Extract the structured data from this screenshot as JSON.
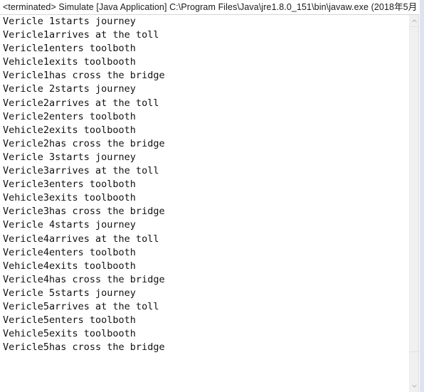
{
  "window": {
    "app": "Eclipse Console",
    "view": "Console"
  },
  "toolbar": {
    "ghost_buttons": [
      "toolbar-ghost-1",
      "toolbar-ghost-2",
      "toolbar-ghost-3"
    ]
  },
  "console": {
    "header": {
      "status": "<terminated>",
      "launch_name": "Simulate",
      "launch_type": "[Java Application]",
      "jvm_path": "C:\\Program Files\\Java\\jre1.8.0_151\\bin\\javaw.exe",
      "timestamp": "(2018年5月",
      "full_title": "<terminated> Simulate [Java Application] C:\\Program Files\\Java\\jre1.8.0_151\\bin\\javaw.exe (2018年5月"
    },
    "output_lines": [
      "Vericle 1starts journey",
      "Vericle1arrives at the toll",
      "Vericle1enters toolboth",
      "Vehicle1exits toolbooth",
      "Vericle1has cross the bridge",
      "Vericle 2starts journey",
      "Vericle2arrives at the toll",
      "Vericle2enters toolboth",
      "Vehicle2exits toolbooth",
      "Vericle2has cross the bridge",
      "Vericle 3starts journey",
      "Vericle3arrives at the toll",
      "Vericle3enters toolboth",
      "Vehicle3exits toolbooth",
      "Vericle3has cross the bridge",
      "Vericle 4starts journey",
      "Vericle4arrives at the toll",
      "Vericle4enters toolboth",
      "Vehicle4exits toolbooth",
      "Vericle4has cross the bridge",
      "Vericle 5starts journey",
      "Vericle5arrives at the toll",
      "Vericle5enters toolboth",
      "Vehicle5exits toolbooth",
      "Vericle5has cross the bridge"
    ]
  },
  "scrollbar": {
    "orientation": "vertical",
    "up_arrow": "chevron-up-icon",
    "down_arrow": "chevron-down-icon",
    "thumb_top_pct": 0,
    "thumb_height_pct": 92
  },
  "colors": {
    "background": "#ffffff",
    "text": "#111111",
    "header_text": "#1a1a1a",
    "rule": "#d6d6d6",
    "scroll_track": "#f0f0f0",
    "pane_edge": "#dde3ef"
  }
}
